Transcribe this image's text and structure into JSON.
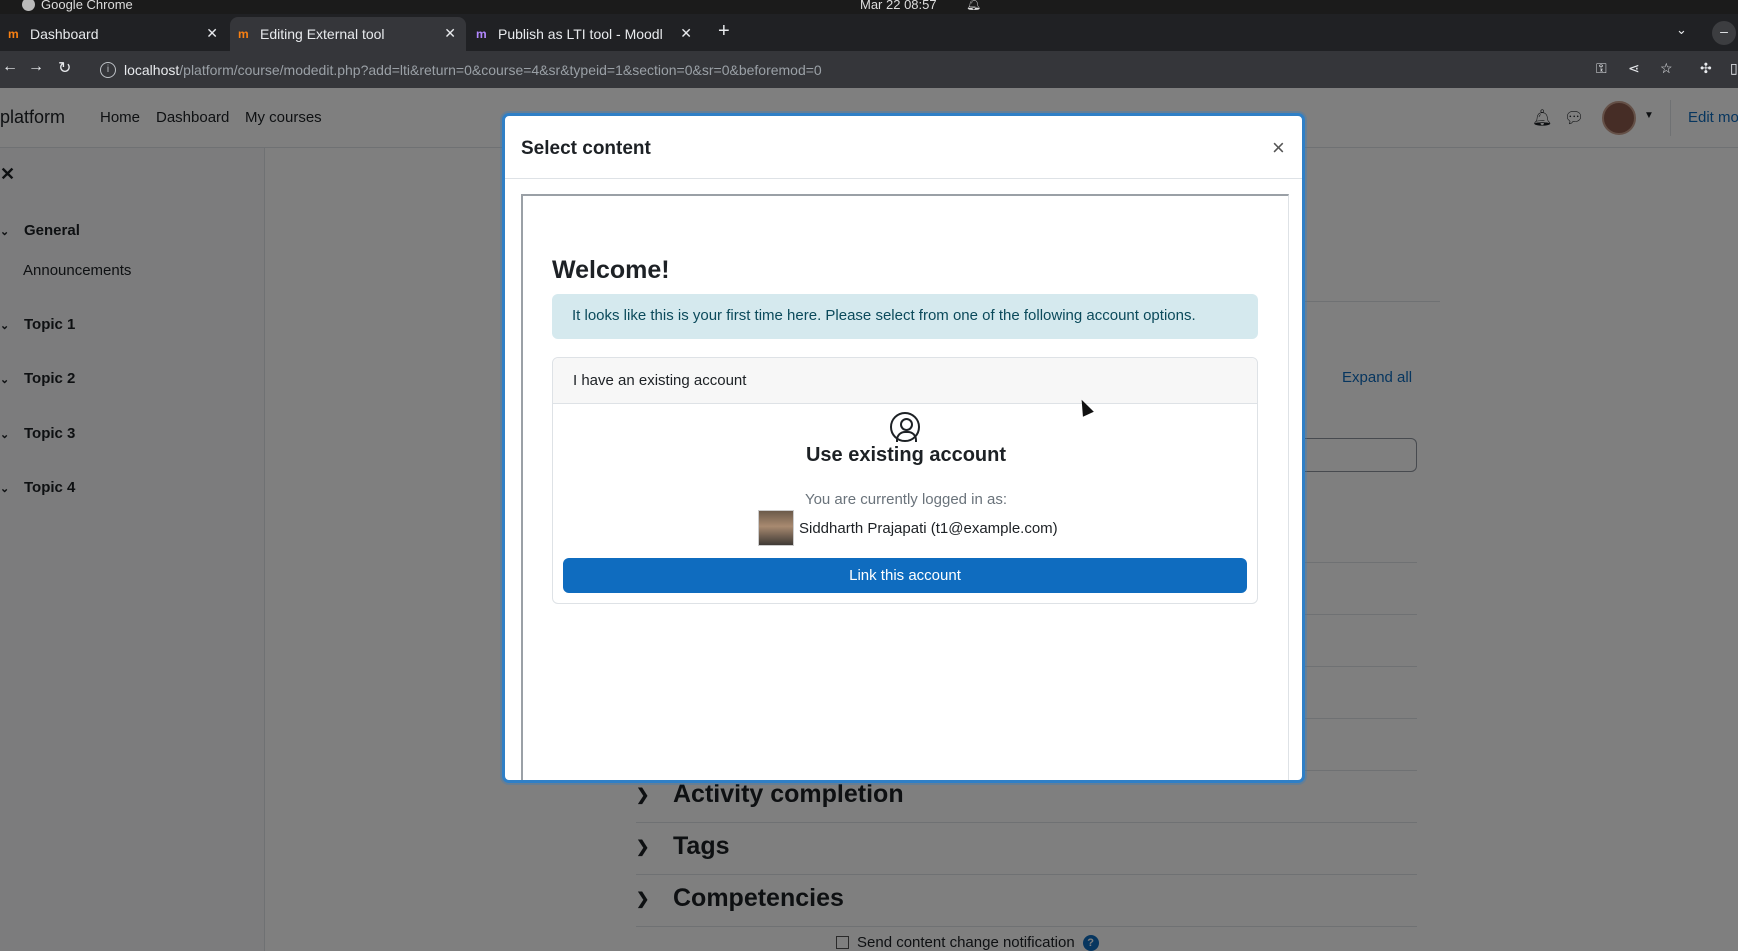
{
  "os": {
    "app_name": "Google Chrome",
    "clock": "Mar 22  08:57"
  },
  "browser": {
    "tabs": [
      {
        "label": "Dashboard",
        "favicon": "moodle-icon"
      },
      {
        "label": "Editing External tool",
        "favicon": "moodle-icon"
      },
      {
        "label": "Publish as LTI tool - Moodl",
        "favicon": "moodle-purple-icon"
      }
    ],
    "url_host": "localhost",
    "url_path": "/platform/course/modedit.php?add=lti&return=0&course=4&sr&typeid=1&section=0&sr=0&beforemod=0"
  },
  "navbar": {
    "brand": "platform",
    "links": [
      "Home",
      "Dashboard",
      "My courses"
    ],
    "edit_mode": "Edit mo"
  },
  "drawer": {
    "sections": [
      {
        "label": "General",
        "items": [
          "Announcements"
        ]
      },
      {
        "label": "Topic 1"
      },
      {
        "label": "Topic 2"
      },
      {
        "label": "Topic 3"
      },
      {
        "label": "Topic 4"
      }
    ]
  },
  "page": {
    "expand_all": "Expand all",
    "sections": [
      "Activity completion",
      "Tags",
      "Competencies"
    ],
    "notification_label": "Send content change notification",
    "help_glyph": "?"
  },
  "modal": {
    "title": "Select content",
    "close_glyph": "×",
    "welcome": "Welcome!",
    "alert": "It looks like this is your first time here. Please select from one of the following account options.",
    "card_header": "I have an existing account",
    "card_title": "Use existing account",
    "logged_in_label": "You are currently logged in as:",
    "user": "Siddharth Prajapati (t1@example.com)",
    "link_button": "Link this account"
  },
  "colors": {
    "primary": "#0f6cbf",
    "alert_bg": "#d5e9ee",
    "modal_border": "#2f7fc6"
  }
}
